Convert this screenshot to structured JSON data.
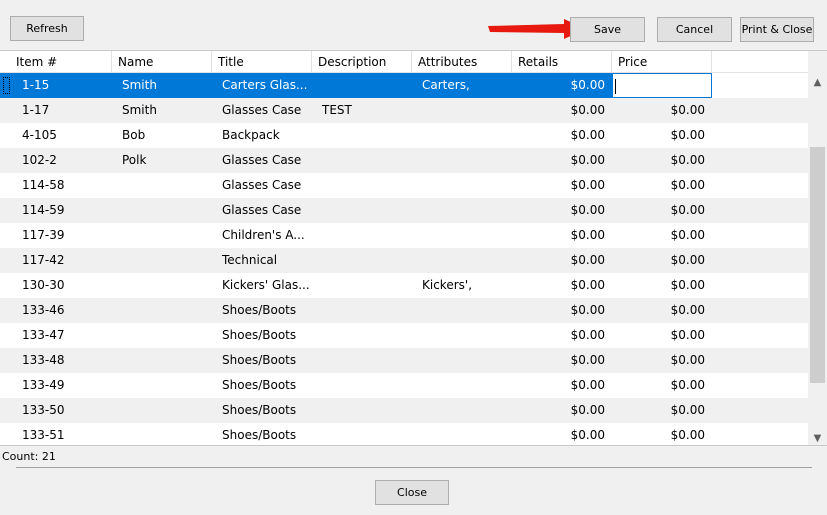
{
  "toolbar": {
    "refresh": "Refresh",
    "save": "Save",
    "cancel": "Cancel",
    "print_close": "Print & Close"
  },
  "grid": {
    "columns": [
      "Item #",
      "Name",
      "Title",
      "Description",
      "Attributes",
      "Retails",
      "Price"
    ],
    "rows": [
      [
        "1-15",
        "Smith",
        "Carters Glas...",
        "",
        "Carters,",
        "$0.00",
        ""
      ],
      [
        "1-17",
        "Smith",
        "Glasses Case",
        "TEST",
        "",
        "$0.00",
        "$0.00"
      ],
      [
        "4-105",
        "Bob",
        "Backpack",
        "",
        "",
        "$0.00",
        "$0.00"
      ],
      [
        "102-2",
        "Polk",
        "Glasses Case",
        "",
        "",
        "$0.00",
        "$0.00"
      ],
      [
        "114-58",
        "",
        "Glasses Case",
        "",
        "",
        "$0.00",
        "$0.00"
      ],
      [
        "114-59",
        "",
        "Glasses Case",
        "",
        "",
        "$0.00",
        "$0.00"
      ],
      [
        "117-39",
        "",
        "Children's A...",
        "",
        "",
        "$0.00",
        "$0.00"
      ],
      [
        "117-42",
        "",
        "Technical",
        "",
        "",
        "$0.00",
        "$0.00"
      ],
      [
        "130-30",
        "",
        "Kickers' Glas...",
        "",
        "Kickers',",
        "$0.00",
        "$0.00"
      ],
      [
        "133-46",
        "",
        "Shoes/Boots",
        "",
        "",
        "$0.00",
        "$0.00"
      ],
      [
        "133-47",
        "",
        "Shoes/Boots",
        "",
        "",
        "$0.00",
        "$0.00"
      ],
      [
        "133-48",
        "",
        "Shoes/Boots",
        "",
        "",
        "$0.00",
        "$0.00"
      ],
      [
        "133-49",
        "",
        "Shoes/Boots",
        "",
        "",
        "$0.00",
        "$0.00"
      ],
      [
        "133-50",
        "",
        "Shoes/Boots",
        "",
        "",
        "$0.00",
        "$0.00"
      ],
      [
        "133-51",
        "",
        "Shoes/Boots",
        "",
        "",
        "$0.00",
        "$0.00"
      ]
    ],
    "selected_row": 0,
    "editing_column": 6
  },
  "status": {
    "count": "Count: 21"
  },
  "footer": {
    "close": "Close"
  },
  "colors": {
    "selection": "#0078d7",
    "alt_row": "#f0f0f0",
    "arrow": "#e8190f"
  }
}
